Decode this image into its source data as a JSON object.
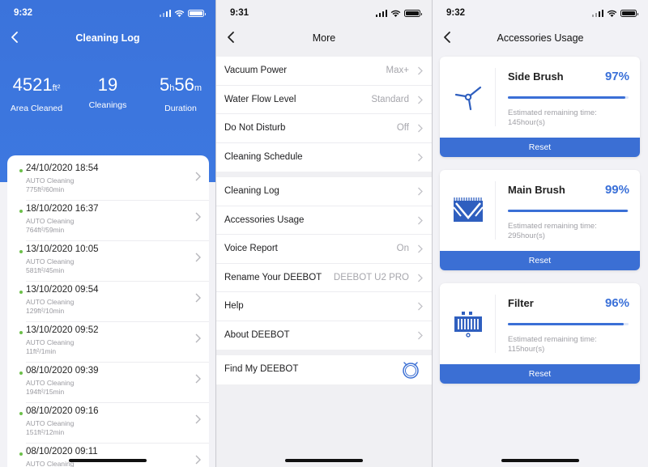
{
  "screens": [
    {
      "status_time": "9:32",
      "title": "Cleaning Log",
      "stats": [
        {
          "value": "4521",
          "unit": "ft²",
          "label": "Area Cleaned"
        },
        {
          "value": "19",
          "unit": "",
          "label": "Cleanings"
        },
        {
          "value_a": "5",
          "unit_a": "h",
          "value_b": "56",
          "unit_b": "m",
          "label": "Duration"
        }
      ],
      "logs": [
        {
          "date": "24/10/2020 18:54",
          "mode": "AUTO Cleaning",
          "area": "775ft²/60min"
        },
        {
          "date": "18/10/2020 16:37",
          "mode": "AUTO Cleaning",
          "area": "764ft²/59min"
        },
        {
          "date": "13/10/2020 10:05",
          "mode": "AUTO Cleaning",
          "area": "581ft²/45min"
        },
        {
          "date": "13/10/2020 09:54",
          "mode": "AUTO Cleaning",
          "area": "129ft²/10min"
        },
        {
          "date": "13/10/2020 09:52",
          "mode": "AUTO Cleaning",
          "area": "11ft²/1min"
        },
        {
          "date": "08/10/2020 09:39",
          "mode": "AUTO Cleaning",
          "area": "194ft²/15min"
        },
        {
          "date": "08/10/2020 09:16",
          "mode": "AUTO Cleaning",
          "area": "151ft²/12min"
        },
        {
          "date": "08/10/2020 09:11",
          "mode": "AUTO Cleaning",
          "area": ""
        }
      ]
    },
    {
      "status_time": "9:31",
      "title": "More",
      "group1": [
        {
          "label": "Vacuum Power",
          "value": "Max+"
        },
        {
          "label": "Water Flow Level",
          "value": "Standard"
        },
        {
          "label": "Do Not Disturb",
          "value": "Off"
        },
        {
          "label": "Cleaning Schedule",
          "value": ""
        }
      ],
      "group2": [
        {
          "label": "Cleaning Log",
          "value": ""
        },
        {
          "label": "Accessories Usage",
          "value": ""
        },
        {
          "label": "Voice Report",
          "value": "On"
        },
        {
          "label": "Rename Your DEEBOT",
          "value": "DEEBOT U2 PRO"
        },
        {
          "label": "Help",
          "value": ""
        },
        {
          "label": "About DEEBOT",
          "value": ""
        }
      ],
      "find": {
        "label": "Find My DEEBOT",
        "icon": "robot-icon"
      }
    },
    {
      "status_time": "9:32",
      "title": "Accessories Usage",
      "accessories": [
        {
          "name": "Side Brush",
          "percent_text": "97%",
          "percent": 97,
          "est_label": "Estimated remaining time:",
          "est_value": "145hour(s)",
          "reset": "Reset",
          "icon": "side-brush-icon"
        },
        {
          "name": "Main Brush",
          "percent_text": "99%",
          "percent": 99,
          "est_label": "Estimated remaining time:",
          "est_value": "295hour(s)",
          "reset": "Reset",
          "icon": "main-brush-icon"
        },
        {
          "name": "Filter",
          "percent_text": "96%",
          "percent": 96,
          "est_label": "Estimated remaining time:",
          "est_value": "115hour(s)",
          "reset": "Reset",
          "icon": "filter-icon"
        }
      ]
    }
  ],
  "colors": {
    "accent": "#3b6fd4",
    "hero": "#3d78e0",
    "dot": "#6cc04a"
  }
}
